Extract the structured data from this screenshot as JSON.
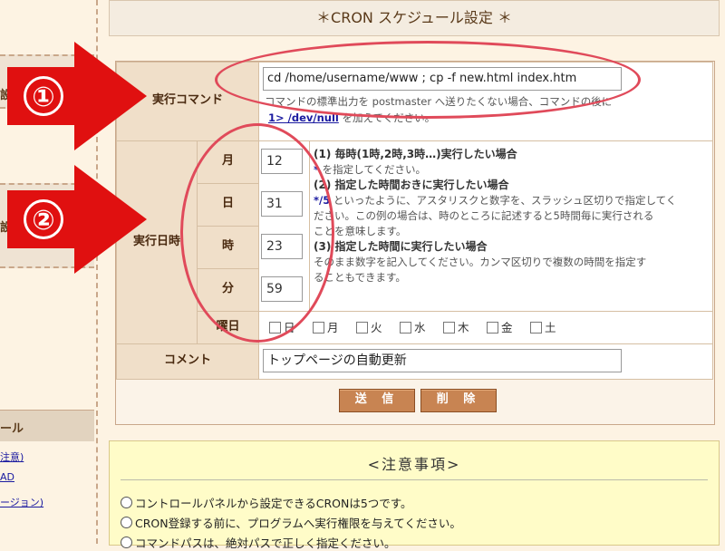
{
  "sidebar": {
    "box1_text": "設定",
    "box2_text": "設",
    "section_title": "ール",
    "links": [
      "注意)",
      "AD",
      "ージョン)"
    ]
  },
  "main": {
    "title": "＊CRON スケジュール設定 ＊"
  },
  "form": {
    "command": {
      "label": "実行コマンド",
      "value": "cd /home/username/www ; cp -f new.html index.htm",
      "help_line1": "コマンドの標準出力を postmaster へ送りたくない場合、コマンドの後に",
      "help_code": "1> /dev/null",
      "help_line2_suffix": " を加えてください。"
    },
    "datetime": {
      "label": "実行日時",
      "fields": [
        {
          "label": "月",
          "value": "12"
        },
        {
          "label": "日",
          "value": "31"
        },
        {
          "label": "時",
          "value": "23"
        },
        {
          "label": "分",
          "value": "59"
        }
      ],
      "help": {
        "h1": "(1) 毎時(1時,2時,3時…)実行したい場合",
        "l1_code": "*",
        "l1_rest": " を指定してください。",
        "h2": "(2) 指定した時間おきに実行したい場合",
        "l2_code": "*/5",
        "l2_rest": " といったように、アスタリスクと数字を、スラッシュ区切りで指定してく",
        "l3": "ださい。この例の場合は、時のところに記述すると5時間毎に実行される",
        "l4": "ことを意味します。",
        "h3": "(3) 指定した時間に実行したい場合",
        "l5": "そのまま数字を記入してください。カンマ区切りで複数の時間を指定す",
        "l6": "ることもできます。"
      }
    },
    "weekday": {
      "label": "曜日",
      "days": [
        "日",
        "月",
        "火",
        "水",
        "木",
        "金",
        "土"
      ]
    },
    "comment": {
      "label": "コメント",
      "value": "トップページの自動更新"
    },
    "buttons": {
      "submit": "送 信",
      "delete": "削 除"
    }
  },
  "annotations": {
    "num1": "①",
    "num2": "②",
    "arrow_color": "#e01010"
  },
  "notice": {
    "title": "<注意事項>",
    "items": [
      "コントロールパネルから設定できるCRONは5つです。",
      "CRON登録する前に、プログラムへ実行権限を与えてください。",
      "コマンドパスは、絶対パスで正しく指定ください。"
    ]
  }
}
